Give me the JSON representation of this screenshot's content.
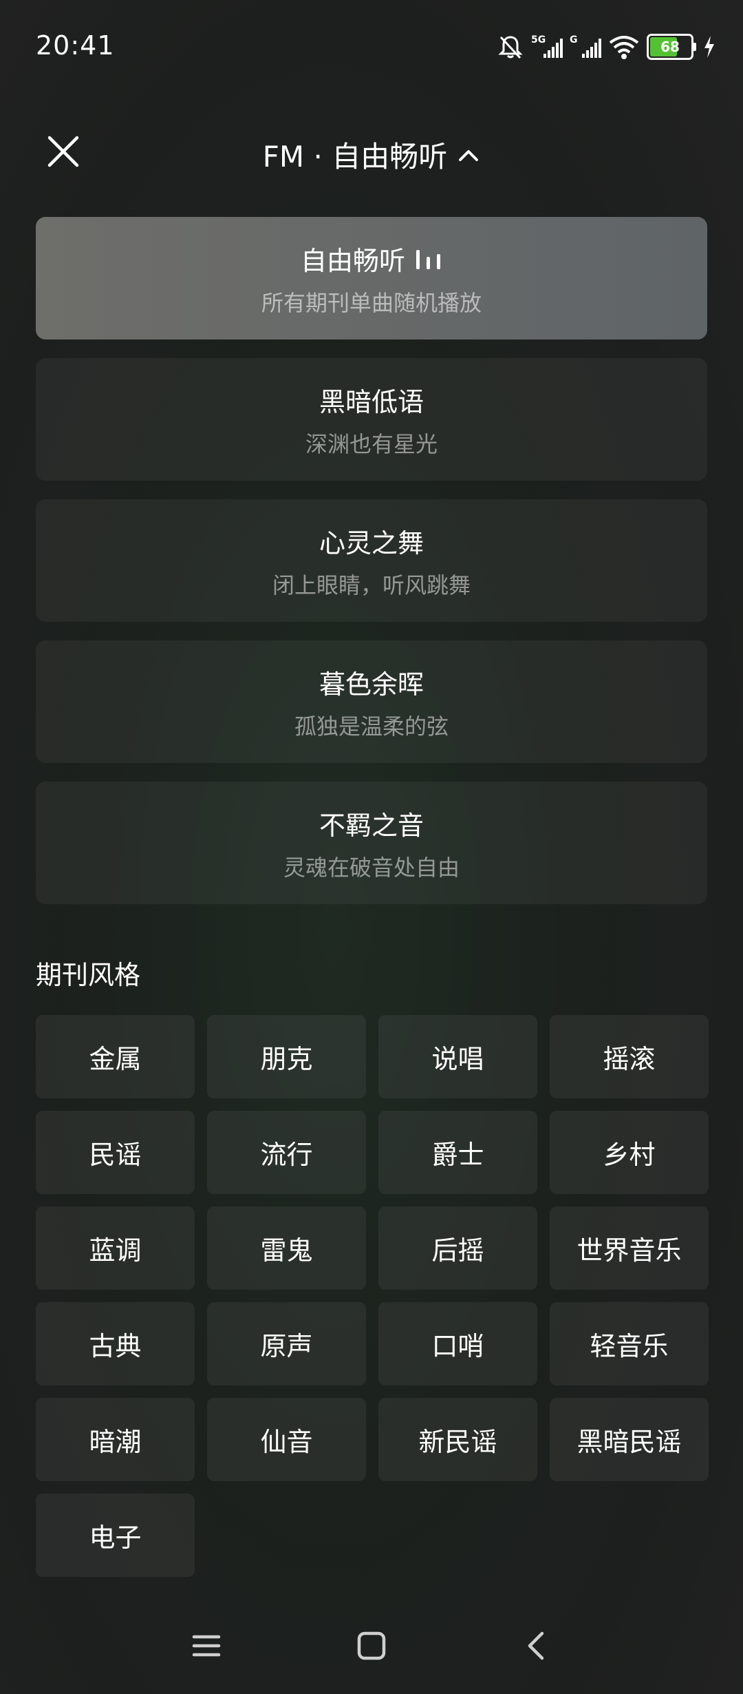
{
  "status_bar": {
    "time": "20:41",
    "network_1": "5G",
    "network_2": "G",
    "battery_level": "68",
    "battery_fraction": 0.68,
    "icons": [
      "bell-off-icon",
      "signal-icon",
      "signal-icon",
      "wifi-icon",
      "battery-icon",
      "charging-icon"
    ]
  },
  "header": {
    "title": "FM · 自由畅听",
    "close_icon": "close-icon",
    "toggle_icon": "chevron-up-icon"
  },
  "channels": [
    {
      "name": "自由畅听",
      "desc": "所有期刊单曲随机播放",
      "active": true,
      "indicator": "playing-bars-icon"
    },
    {
      "name": "黑暗低语",
      "desc": "深渊也有星光",
      "active": false
    },
    {
      "name": "心灵之舞",
      "desc": "闭上眼睛，听风跳舞",
      "active": false
    },
    {
      "name": "暮色余晖",
      "desc": "孤独是温柔的弦",
      "active": false
    },
    {
      "name": "不羁之音",
      "desc": "灵魂在破音处自由",
      "active": false
    }
  ],
  "genre_section": {
    "title": "期刊风格",
    "items": [
      "金属",
      "朋克",
      "说唱",
      "摇滚",
      "民谣",
      "流行",
      "爵士",
      "乡村",
      "蓝调",
      "雷鬼",
      "后摇",
      "世界音乐",
      "古典",
      "原声",
      "口哨",
      "轻音乐",
      "暗潮",
      "仙音",
      "新民谣",
      "黑暗民谣",
      "电子"
    ]
  },
  "nav_bar": {
    "icons": [
      "menu-icon",
      "home-square-icon",
      "back-icon"
    ]
  },
  "colors": {
    "battery_fill": "#54c132",
    "active_card": "#6e6e6a"
  }
}
